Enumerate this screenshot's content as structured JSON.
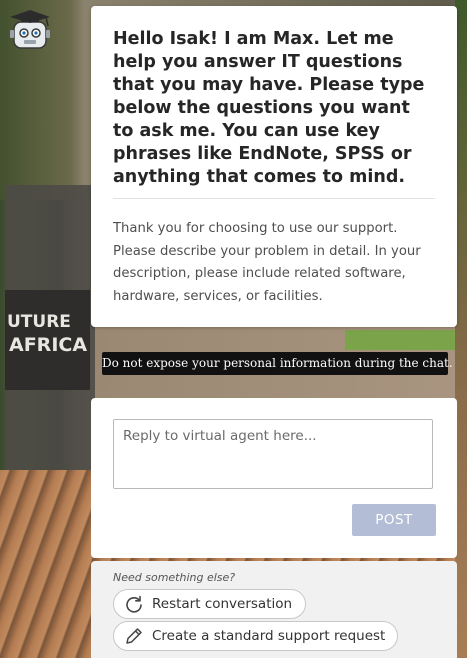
{
  "bot_message": {
    "intro": "Hello Isak! I am Max. Let me help you answer IT questions that you may have. Please type below the questions you want to ask me. You can use key phrases like EndNote, SPSS or anything that comes to mind.",
    "body": "Thank you for choosing to use our support. Please describe your problem in detail. In your description, please include related software, hardware, services, or facilities."
  },
  "notice": "Do not expose your personal information during the chat.",
  "reply": {
    "placeholder": "Reply to virtual agent here...",
    "post_label": "POST"
  },
  "options": {
    "heading": "Need something else?",
    "items": [
      {
        "label": "Restart conversation",
        "icon": "restart-icon"
      },
      {
        "label": "Create a standard support request",
        "icon": "pencil-icon"
      }
    ]
  },
  "background_sign": {
    "line1": "UTURE",
    "line2": "AFRICA"
  },
  "colors": {
    "post_button": "#b3bdd5",
    "notice_bg": "#111111",
    "card_bg": "#ffffff"
  }
}
